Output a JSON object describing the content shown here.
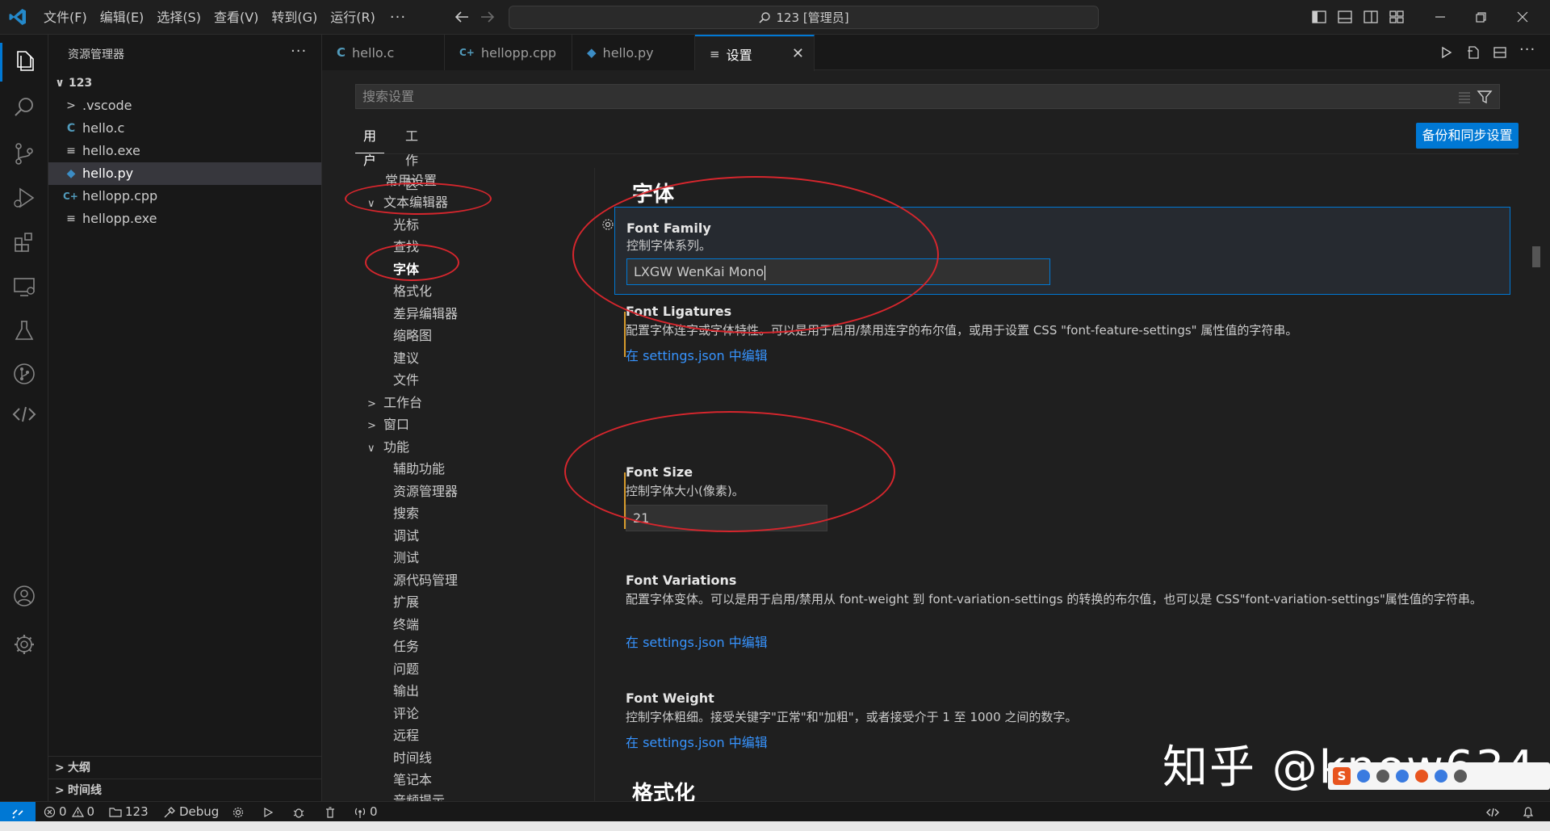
{
  "titlebar": {
    "menus": [
      "文件(F)",
      "编辑(E)",
      "选择(S)",
      "查看(V)",
      "转到(G)",
      "运行(R)"
    ],
    "more": "···",
    "command_center": "123 [管理员]"
  },
  "sidebar": {
    "title": "资源管理器",
    "more": "···",
    "folder": "123",
    "items": [
      {
        "label": ".vscode",
        "kind": "folder",
        "icon": ">"
      },
      {
        "label": "hello.c",
        "kind": "c",
        "icon": "C"
      },
      {
        "label": "hello.exe",
        "kind": "exe",
        "icon": "≡"
      },
      {
        "label": "hello.py",
        "kind": "py",
        "icon": "◆"
      },
      {
        "label": "hellopp.cpp",
        "kind": "cpp",
        "icon": "C+"
      },
      {
        "label": "hellopp.exe",
        "kind": "exe",
        "icon": "≡"
      }
    ],
    "sections": [
      "大纲",
      "时间线"
    ]
  },
  "tabs": [
    {
      "label": "hello.c",
      "icon": "C",
      "color": "#519aba"
    },
    {
      "label": "hellopp.cpp",
      "icon": "C+",
      "color": "#519aba"
    },
    {
      "label": "hello.py",
      "icon": "◆",
      "color": "#3c8dc5"
    },
    {
      "label": "设置",
      "icon": "≡",
      "color": "#cccccc",
      "close": "✕"
    }
  ],
  "settings": {
    "search_placeholder": "搜索设置",
    "scopes": [
      "用户",
      "工作区"
    ],
    "sync_button": "备份和同步设置",
    "toc": [
      {
        "label": "常用设置",
        "level": 0
      },
      {
        "label": "文本编辑器",
        "level": 0,
        "chev": "∨"
      },
      {
        "label": "光标",
        "level": 1
      },
      {
        "label": "查找",
        "level": 1
      },
      {
        "label": "字体",
        "level": 1,
        "selected": true
      },
      {
        "label": "格式化",
        "level": 1
      },
      {
        "label": "差异编辑器",
        "level": 1
      },
      {
        "label": "缩略图",
        "level": 1
      },
      {
        "label": "建议",
        "level": 1
      },
      {
        "label": "文件",
        "level": 1
      },
      {
        "label": "工作台",
        "level": 0,
        "chev": ">"
      },
      {
        "label": "窗口",
        "level": 0,
        "chev": ">"
      },
      {
        "label": "功能",
        "level": 0,
        "chev": "∨"
      },
      {
        "label": "辅助功能",
        "level": 1
      },
      {
        "label": "资源管理器",
        "level": 1
      },
      {
        "label": "搜索",
        "level": 1
      },
      {
        "label": "调试",
        "level": 1
      },
      {
        "label": "测试",
        "level": 1
      },
      {
        "label": "源代码管理",
        "level": 1
      },
      {
        "label": "扩展",
        "level": 1
      },
      {
        "label": "终端",
        "level": 1
      },
      {
        "label": "任务",
        "level": 1
      },
      {
        "label": "问题",
        "level": 1
      },
      {
        "label": "输出",
        "level": 1
      },
      {
        "label": "评论",
        "level": 1
      },
      {
        "label": "远程",
        "level": 1
      },
      {
        "label": "时间线",
        "level": 1
      },
      {
        "label": "笔记本",
        "level": 1
      },
      {
        "label": "音频提示",
        "level": 1
      }
    ],
    "group_title": "字体",
    "next_group_title": "格式化",
    "font_family": {
      "title": "Font Family",
      "desc": "控制字体系列。",
      "value": "LXGW WenKai Mono"
    },
    "font_ligatures": {
      "title": "Font Ligatures",
      "desc": "配置字体连字或字体特性。可以是用于启用/禁用连字的布尔值，或用于设置 CSS \"font-feature-settings\" 属性值的字符串。",
      "link": "在 settings.json 中编辑"
    },
    "font_size": {
      "title": "Font Size",
      "desc": "控制字体大小(像素)。",
      "value": "21"
    },
    "font_variations": {
      "title": "Font Variations",
      "desc": "配置字体变体。可以是用于启用/禁用从 font-weight 到 font-variation-settings 的转换的布尔值，也可以是 CSS\"font-variation-settings\"属性值的字符串。",
      "link": "在 settings.json 中编辑"
    },
    "font_weight": {
      "title": "Font Weight",
      "desc": "控制字体粗细。接受关键字\"正常\"和\"加粗\"，或者接受介于 1 至 1000 之间的数字。",
      "link": "在 settings.json 中编辑"
    }
  },
  "statusbar": {
    "errors": "0",
    "warnings": "0",
    "workspace": "123",
    "debug": "Debug",
    "ports": "0"
  },
  "watermark": "知乎 @know634",
  "colors": {
    "accent": "#0078d4",
    "link": "#3794ff",
    "modified_marker": "#d79b2c",
    "annotation": "#d6262d"
  }
}
